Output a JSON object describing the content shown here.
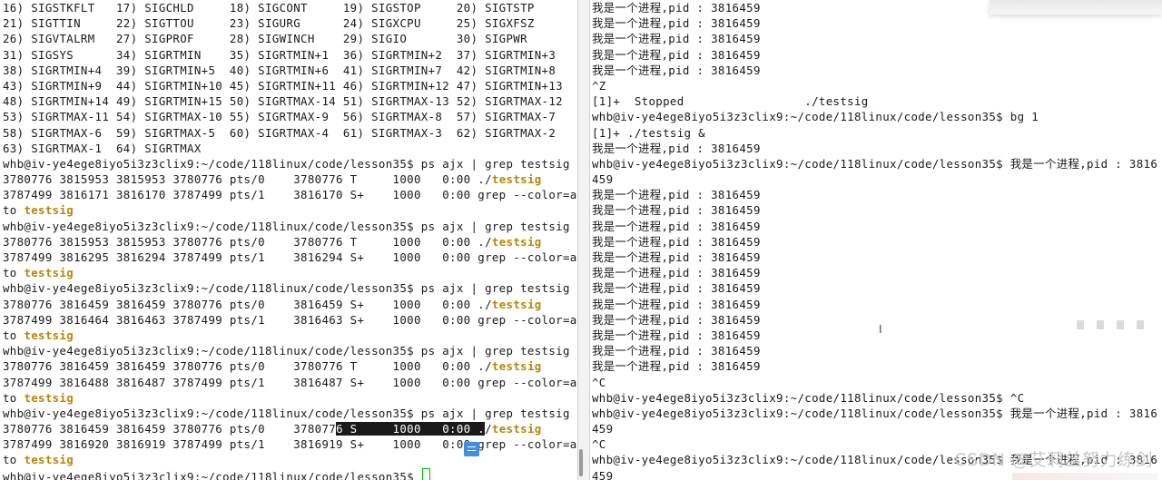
{
  "left_terminal": {
    "lines": [
      "16) SIGSTKFLT   17) SIGCHLD     18) SIGCONT     19) SIGSTOP     20) SIGTSTP",
      "21) SIGTTIN     22) SIGTTOU     23) SIGURG      24) SIGXCPU     25) SIGXFSZ",
      "26) SIGVTALRM   27) SIGPROF     28) SIGWINCH    29) SIGIO       30) SIGPWR",
      "31) SIGSYS      34) SIGRTMIN    35) SIGRTMIN+1  36) SIGRTMIN+2  37) SIGRTMIN+3",
      "38) SIGRTMIN+4  39) SIGRTMIN+5  40) SIGRTMIN+6  41) SIGRTMIN+7  42) SIGRTMIN+8",
      "43) SIGRTMIN+9  44) SIGRTMIN+10 45) SIGRTMIN+11 46) SIGRTMIN+12 47) SIGRTMIN+13",
      "48) SIGRTMIN+14 49) SIGRTMIN+15 50) SIGRTMAX-14 51) SIGRTMAX-13 52) SIGRTMAX-12",
      "53) SIGRTMAX-11 54) SIGRTMAX-10 55) SIGRTMAX-9  56) SIGRTMAX-8  57) SIGRTMAX-7",
      "58) SIGRTMAX-6  59) SIGRTMAX-5  60) SIGRTMAX-4  61) SIGRTMAX-3  62) SIGRTMAX-2",
      "63) SIGRTMAX-1  64) SIGRTMAX",
      "whb@iv-ye4ege8iyo5i3z3clix9:~/code/118linux/code/lesson35$ ps ajx | grep testsig",
      "3780776 3815953 3815953 3780776 pts/0    3780776 T     1000   0:00 ./",
      "3787499 3816171 3816170 3787499 pts/1    3816170 S+    1000   0:00 grep --color=au",
      "to ",
      "whb@iv-ye4ege8iyo5i3z3clix9:~/code/118linux/code/lesson35$ ps ajx | grep testsig",
      "3780776 3815953 3815953 3780776 pts/0    3780776 T     1000   0:00 ./",
      "3787499 3816295 3816294 3787499 pts/1    3816294 S+    1000   0:00 grep --color=au",
      "to ",
      "whb@iv-ye4ege8iyo5i3z3clix9:~/code/118linux/code/lesson35$ ps ajx | grep testsig",
      "3780776 3816459 3816459 3780776 pts/0    3816459 S+    1000   0:00 ./",
      "3787499 3816464 3816463 3787499 pts/1    3816463 S+    1000   0:00 grep --color=au",
      "to ",
      "whb@iv-ye4ege8iyo5i3z3clix9:~/code/118linux/code/lesson35$ ps ajx | grep testsig",
      "3780776 3816459 3816459 3780776 pts/0    3780776 T     1000   0:00 ./",
      "3787499 3816488 3816487 3787499 pts/1    3816487 S+    1000   0:00 grep --color=au",
      "to ",
      "whb@iv-ye4ege8iyo5i3z3clix9:~/code/118linux/code/lesson35$ ps ajx | grep testsig",
      "3780776 3816459 3816459 3780776 pts/0    378077",
      "3787499 3816920 3816919 3787499 pts/1    3816919 S+    1000   0:00 grep --color=au",
      "to ",
      "whb@iv-ye4ege8iyo5i3z3clix9:~/code/118linux/code/lesson35$ "
    ],
    "match_word": "testsig",
    "selected_text": "6 S     1000   0:00 .",
    "after_selection": "/"
  },
  "right_terminal": {
    "lines": [
      "我是一个进程,pid : 3816459",
      "我是一个进程,pid : 3816459",
      "我是一个进程,pid : 3816459",
      "我是一个进程,pid : 3816459",
      "我是一个进程,pid : 3816459",
      "^Z",
      "[1]+  Stopped                 ./testsig",
      "whb@iv-ye4ege8iyo5i3z3clix9:~/code/118linux/code/lesson35$ bg 1",
      "[1]+ ./testsig &",
      "我是一个进程,pid : 3816459",
      "whb@iv-ye4ege8iyo5i3z3clix9:~/code/118linux/code/lesson35$ 我是一个进程,pid : 3816",
      "459",
      "我是一个进程,pid : 3816459",
      "我是一个进程,pid : 3816459",
      "我是一个进程,pid : 3816459",
      "我是一个进程,pid : 3816459",
      "我是一个进程,pid : 3816459",
      "我是一个进程,pid : 3816459",
      "我是一个进程,pid : 3816459",
      "我是一个进程,pid : 3816459",
      "我是一个进程,pid : 3816459",
      "我是一个进程,pid : 3816459",
      "我是一个进程,pid : 3816459",
      "我是一个进程,pid : 3816459",
      "^C",
      "whb@iv-ye4ege8iyo5i3z3clix9:~/code/118linux/code/lesson35$ ^C",
      "whb@iv-ye4ege8iyo5i3z3clix9:~/code/118linux/code/lesson35$ 我是一个进程,pid : 3816",
      "459",
      "^C",
      "whb@iv-ye4ege8iyo5i3z3clix9:~/code/118linux/code/lesson35$ 我是一个进程,pid : 3816",
      "459"
    ]
  },
  "watermark": "CSDN @艾莉丝努力练剑",
  "colors": {
    "background": "#ffffff",
    "text": "#1a1a1a",
    "grep_match": "#b8860b",
    "cursor": "#00c000",
    "selection_bg": "#1a1a1a"
  },
  "icons": {
    "floating": "edit-toolbar-icon",
    "text_cursor": "i-beam-icon"
  }
}
